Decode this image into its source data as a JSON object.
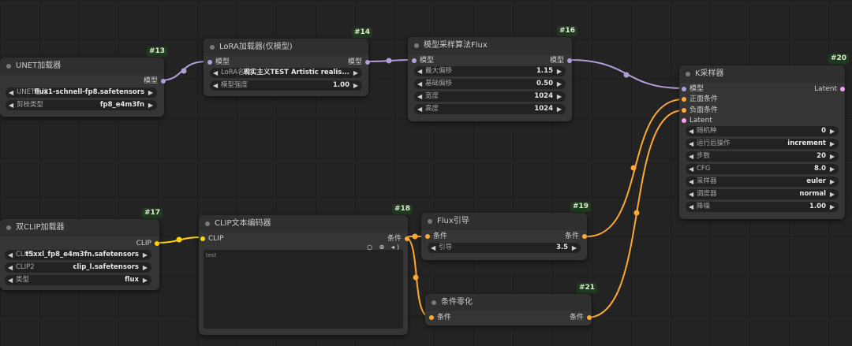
{
  "colors": {
    "model": "#b39ddb",
    "clip": "#ffd500",
    "conditioning": "#ffa931",
    "latent": "#ff9cf9",
    "canvas": "#232323",
    "node": "#353535"
  },
  "nodes": {
    "unet": {
      "title": "UNET加载器",
      "id": "#13",
      "out_model": "模型",
      "w1_label": "UNET名称",
      "w1_value": "flux1-schnell-fp8.safetensors",
      "w2_label": "剪枝类型",
      "w2_value": "fp8_e4m3fn"
    },
    "lora": {
      "title": "LoRA加载器(仅模型)",
      "id": "#14",
      "in_model": "模型",
      "out_model": "模型",
      "w1_label": "LoRA名称",
      "w1_value": "现实主义TEST Artistic realis...",
      "w2_label": "模型强度",
      "w2_value": "1.00"
    },
    "sampling": {
      "title": "模型采样算法Flux",
      "id": "#16",
      "in_model": "模型",
      "out_model": "模型",
      "w1_label": "最大偏移",
      "w1_value": "1.15",
      "w2_label": "基础偏移",
      "w2_value": "0.50",
      "w3_label": "宽度",
      "w3_value": "1024",
      "w4_label": "高度",
      "w4_value": "1024"
    },
    "ksampler": {
      "title": "K采样器",
      "id": "#20",
      "in_model": "模型",
      "in_pos": "正面条件",
      "in_neg": "负面条件",
      "in_latent": "Latent",
      "out_latent": "Latent",
      "w1_label": "随机种",
      "w1_value": "0",
      "w2_label": "运行后操作",
      "w2_value": "increment",
      "w3_label": "步数",
      "w3_value": "20",
      "w4_label": "CFG",
      "w4_value": "8.0",
      "w5_label": "采样器",
      "w5_value": "euler",
      "w6_label": "调度器",
      "w6_value": "normal",
      "w7_label": "降噪",
      "w7_value": "1.00"
    },
    "dualclip": {
      "title": "双CLIP加载器",
      "id": "#17",
      "out_clip": "CLIP",
      "w1_label": "CLIP1",
      "w1_value": "t5xxl_fp8_e4m3fn.safetensors",
      "w2_label": "CLIP2",
      "w2_value": "clip_l.safetensors",
      "w3_label": "类型",
      "w3_value": "flux"
    },
    "clipenc": {
      "title": "CLIP文本编码器",
      "id": "#18",
      "in_clip": "CLIP",
      "out_cond": "条件",
      "text": "test",
      "icons": "○ ⊕ ◂)"
    },
    "fluxguide": {
      "title": "Flux引导",
      "id": "#19",
      "in_cond": "条件",
      "out_cond": "条件",
      "w1_label": "引导",
      "w1_value": "3.5"
    },
    "zero": {
      "title": "条件零化",
      "id": "#21",
      "in_cond": "条件",
      "out_cond": "条件"
    }
  }
}
